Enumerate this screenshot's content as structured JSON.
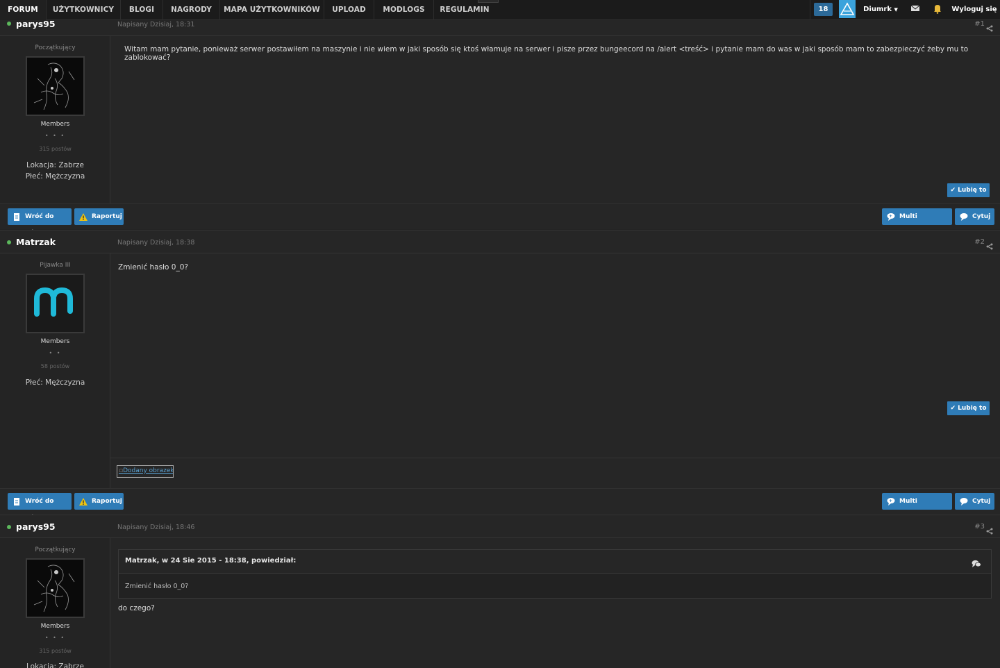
{
  "nav": {
    "items": [
      "FORUM",
      "UŻYTKOWNICY",
      "BLOGI",
      "NAGRODY",
      "MAPA UŻYTKOWNIKÓW",
      "UPLOAD",
      "MODLOGS",
      "REGULAMIN"
    ],
    "notification_count": "18",
    "username": "Diumrk",
    "logout": "Wyloguj się"
  },
  "posts": [
    {
      "author": "parys95",
      "date": "Napisany Dzisiaj, 18:31",
      "number": "#1",
      "rank": "Początkujący",
      "group": "Members",
      "pips": "• • •",
      "post_count": "315 postów",
      "location": "Lokacja: Zabrze",
      "gender": "Płeć: Mężczyzna",
      "content": "Witam mam pytanie, ponieważ serwer postawiłem na maszynie i nie wiem w jaki sposób się ktoś włamuje na serwer i pisze przez bungeecord na /alert <treść> i pytanie mam do was w jaki sposób mam to zabezpieczyć żeby mu to zablokować?",
      "like": "✔ Lubię to",
      "buttons": {
        "top": "Wróć do góry",
        "report": "Raportuj",
        "multiquote": "Multi cytowanie",
        "quote": "Cytuj"
      }
    },
    {
      "author": "Matrzak",
      "date": "Napisany Dzisiaj, 18:38",
      "number": "#2",
      "rank": "Pijawka III",
      "group": "Members",
      "pips": "• •",
      "post_count": "58 postów",
      "gender": "Płeć: Mężczyzna",
      "content": "Zmienić hasło 0_0?",
      "like": "✔ Lubię to",
      "signature_image": "Dodany obrazek",
      "buttons": {
        "top": "Wróć do góry",
        "report": "Raportuj",
        "multiquote": "Multi cytowanie",
        "quote": "Cytuj"
      }
    },
    {
      "author": "parys95",
      "date": "Napisany Dzisiaj, 18:46",
      "number": "#3",
      "rank": "Początkujący",
      "group": "Members",
      "pips": "• • •",
      "post_count": "315 postów",
      "location": "Lokacja: Zabrze",
      "quote_header": "Matrzak, w 24 Sie 2015 - 18:38, powiedział:",
      "quote_text": "Zmienić hasło 0_0?",
      "content": "do czego?"
    }
  ],
  "colors": {
    "accent": "#2f7cb7",
    "online": "#5cb85c",
    "background": "#242424"
  }
}
